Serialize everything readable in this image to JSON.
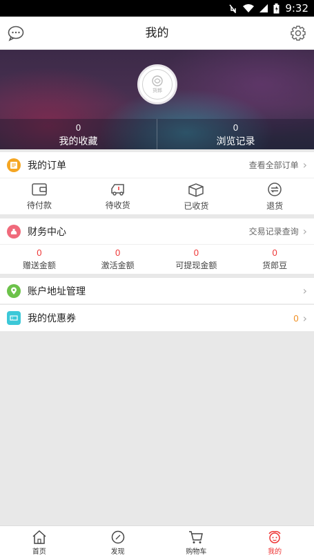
{
  "status_bar": {
    "time": "9:32"
  },
  "header": {
    "title": "我的"
  },
  "profile": {
    "avatar_caption": "货郎",
    "stats": [
      {
        "value": "0",
        "label": "我的收藏"
      },
      {
        "value": "0",
        "label": "浏览记录"
      }
    ]
  },
  "orders": {
    "title": "我的订单",
    "link": "查看全部订单",
    "items": [
      {
        "label": "待付款",
        "icon": "wallet-icon"
      },
      {
        "label": "待收货",
        "icon": "truck-icon"
      },
      {
        "label": "已收货",
        "icon": "box-icon"
      },
      {
        "label": "退货",
        "icon": "return-icon"
      }
    ]
  },
  "finance": {
    "title": "财务中心",
    "link": "交易记录查询",
    "items": [
      {
        "value": "0",
        "label": "赠送金额"
      },
      {
        "value": "0",
        "label": "激活金额"
      },
      {
        "value": "0",
        "label": "可提现金额"
      },
      {
        "value": "0",
        "label": "货郎豆"
      }
    ]
  },
  "address": {
    "title": "账户地址管理"
  },
  "coupons": {
    "title": "我的优惠券",
    "count": "0"
  },
  "bottom_nav": [
    {
      "label": "首页",
      "icon": "home-icon"
    },
    {
      "label": "发现",
      "icon": "compass-icon"
    },
    {
      "label": "购物车",
      "icon": "cart-icon"
    },
    {
      "label": "我的",
      "icon": "profile-icon",
      "active": true
    }
  ],
  "colors": {
    "accent": "#ee3333",
    "orders_icon": "#f5a623",
    "finance_icon": "#f06a7b",
    "address_icon": "#6cc24a",
    "coupon_icon": "#3cc8d8",
    "coupon_count": "#f08a18"
  }
}
